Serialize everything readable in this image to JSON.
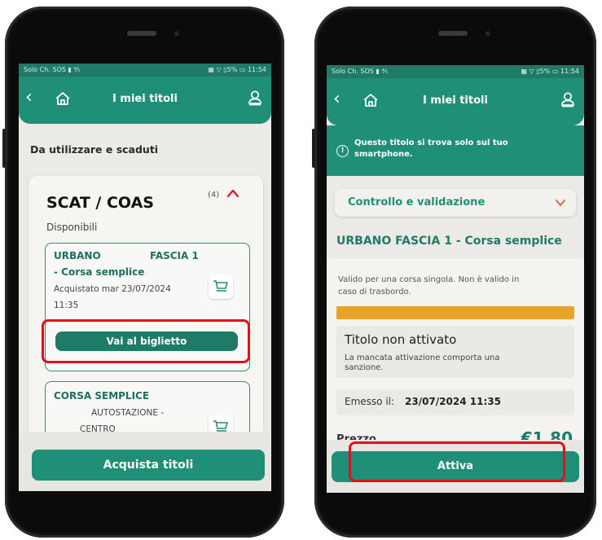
{
  "left": {
    "status": {
      "carrier": "Solo Ch. SOS ▮ ⅘",
      "indicators": "▦ ▽ ▯5% ▭ 11:54"
    },
    "header": {
      "back": "‹",
      "title": "I miei titoli"
    },
    "section_title": "Da utilizzare e scaduti",
    "company": {
      "name": "SCAT / COAS",
      "count": "(4)",
      "chevron": "^",
      "available_label": "Disponibili"
    },
    "ticket1": {
      "line1_left": "URBANO",
      "line1_right": "FASCIA 1",
      "line2": "- Corsa semplice",
      "purchased_line1": "Acquistato mar 23/07/2024",
      "purchased_line2": "11:35",
      "button": "Vai al biglietto"
    },
    "ticket2": {
      "title": "CORSA SEMPLICE",
      "line1": "AUTOSTAZIONE -",
      "line2": "CENTRO"
    },
    "buy_button": "Acquista titoli"
  },
  "right": {
    "status": {
      "carrier": "Solo Ch. SOS ▮ ⅘",
      "indicators": "▦ ▽ ▯5% ▭ 11:54"
    },
    "header": {
      "back": "‹",
      "title": "I miei titoli"
    },
    "banner": {
      "icon": "!",
      "text_line1": "Questo titolo si trova solo sul tuo",
      "text_line2": "smartphone."
    },
    "control": {
      "label": "Controllo e validazione",
      "chevron": "∨"
    },
    "ticket_title": "URBANO FASCIA 1 - Corsa semplice",
    "description_line1": "Valido per una corsa singola. Non è valido in",
    "description_line2": "caso di trasbordo.",
    "status_box": {
      "title": "Titolo non attivato",
      "line1": "La mancata attivazione comporta una",
      "line2": "sanzione."
    },
    "issued": {
      "label": "Emesso il:",
      "value": "23/07/2024 11:35"
    },
    "price": {
      "label": "Prezzo",
      "value": "€1,80"
    },
    "activate_button": "Attiva"
  },
  "colors": {
    "primary": "#1f8f78",
    "dark_green": "#1f7a68",
    "accent_orange": "#e8a32a",
    "highlight_red": "#e3101a"
  }
}
